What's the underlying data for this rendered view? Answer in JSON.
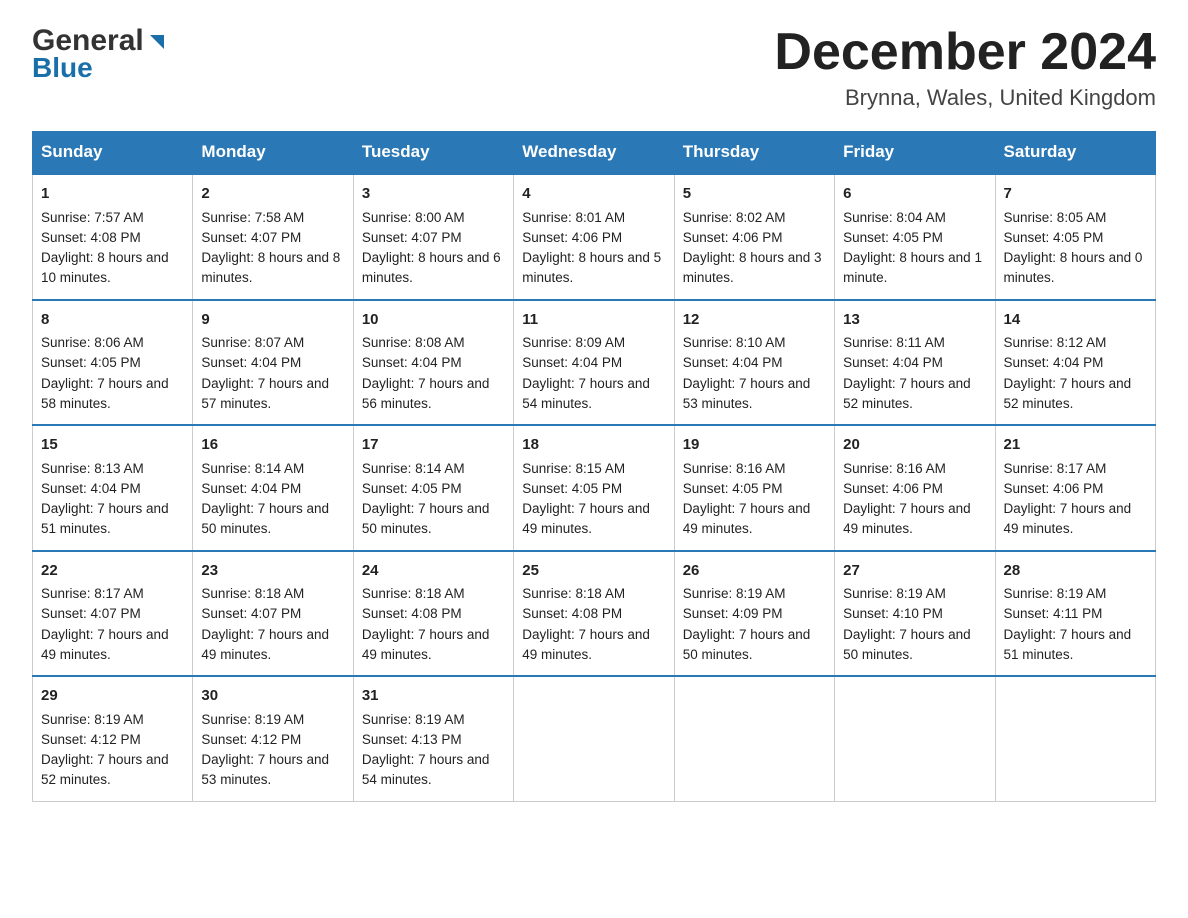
{
  "logo": {
    "general": "General",
    "triangle": "▶",
    "blue": "Blue"
  },
  "title": {
    "month": "December 2024",
    "location": "Brynna, Wales, United Kingdom"
  },
  "headers": [
    "Sunday",
    "Monday",
    "Tuesday",
    "Wednesday",
    "Thursday",
    "Friday",
    "Saturday"
  ],
  "weeks": [
    [
      {
        "day": "1",
        "sunrise": "7:57 AM",
        "sunset": "4:08 PM",
        "daylight": "8 hours and 10 minutes."
      },
      {
        "day": "2",
        "sunrise": "7:58 AM",
        "sunset": "4:07 PM",
        "daylight": "8 hours and 8 minutes."
      },
      {
        "day": "3",
        "sunrise": "8:00 AM",
        "sunset": "4:07 PM",
        "daylight": "8 hours and 6 minutes."
      },
      {
        "day": "4",
        "sunrise": "8:01 AM",
        "sunset": "4:06 PM",
        "daylight": "8 hours and 5 minutes."
      },
      {
        "day": "5",
        "sunrise": "8:02 AM",
        "sunset": "4:06 PM",
        "daylight": "8 hours and 3 minutes."
      },
      {
        "day": "6",
        "sunrise": "8:04 AM",
        "sunset": "4:05 PM",
        "daylight": "8 hours and 1 minute."
      },
      {
        "day": "7",
        "sunrise": "8:05 AM",
        "sunset": "4:05 PM",
        "daylight": "8 hours and 0 minutes."
      }
    ],
    [
      {
        "day": "8",
        "sunrise": "8:06 AM",
        "sunset": "4:05 PM",
        "daylight": "7 hours and 58 minutes."
      },
      {
        "day": "9",
        "sunrise": "8:07 AM",
        "sunset": "4:04 PM",
        "daylight": "7 hours and 57 minutes."
      },
      {
        "day": "10",
        "sunrise": "8:08 AM",
        "sunset": "4:04 PM",
        "daylight": "7 hours and 56 minutes."
      },
      {
        "day": "11",
        "sunrise": "8:09 AM",
        "sunset": "4:04 PM",
        "daylight": "7 hours and 54 minutes."
      },
      {
        "day": "12",
        "sunrise": "8:10 AM",
        "sunset": "4:04 PM",
        "daylight": "7 hours and 53 minutes."
      },
      {
        "day": "13",
        "sunrise": "8:11 AM",
        "sunset": "4:04 PM",
        "daylight": "7 hours and 52 minutes."
      },
      {
        "day": "14",
        "sunrise": "8:12 AM",
        "sunset": "4:04 PM",
        "daylight": "7 hours and 52 minutes."
      }
    ],
    [
      {
        "day": "15",
        "sunrise": "8:13 AM",
        "sunset": "4:04 PM",
        "daylight": "7 hours and 51 minutes."
      },
      {
        "day": "16",
        "sunrise": "8:14 AM",
        "sunset": "4:04 PM",
        "daylight": "7 hours and 50 minutes."
      },
      {
        "day": "17",
        "sunrise": "8:14 AM",
        "sunset": "4:05 PM",
        "daylight": "7 hours and 50 minutes."
      },
      {
        "day": "18",
        "sunrise": "8:15 AM",
        "sunset": "4:05 PM",
        "daylight": "7 hours and 49 minutes."
      },
      {
        "day": "19",
        "sunrise": "8:16 AM",
        "sunset": "4:05 PM",
        "daylight": "7 hours and 49 minutes."
      },
      {
        "day": "20",
        "sunrise": "8:16 AM",
        "sunset": "4:06 PM",
        "daylight": "7 hours and 49 minutes."
      },
      {
        "day": "21",
        "sunrise": "8:17 AM",
        "sunset": "4:06 PM",
        "daylight": "7 hours and 49 minutes."
      }
    ],
    [
      {
        "day": "22",
        "sunrise": "8:17 AM",
        "sunset": "4:07 PM",
        "daylight": "7 hours and 49 minutes."
      },
      {
        "day": "23",
        "sunrise": "8:18 AM",
        "sunset": "4:07 PM",
        "daylight": "7 hours and 49 minutes."
      },
      {
        "day": "24",
        "sunrise": "8:18 AM",
        "sunset": "4:08 PM",
        "daylight": "7 hours and 49 minutes."
      },
      {
        "day": "25",
        "sunrise": "8:18 AM",
        "sunset": "4:08 PM",
        "daylight": "7 hours and 49 minutes."
      },
      {
        "day": "26",
        "sunrise": "8:19 AM",
        "sunset": "4:09 PM",
        "daylight": "7 hours and 50 minutes."
      },
      {
        "day": "27",
        "sunrise": "8:19 AM",
        "sunset": "4:10 PM",
        "daylight": "7 hours and 50 minutes."
      },
      {
        "day": "28",
        "sunrise": "8:19 AM",
        "sunset": "4:11 PM",
        "daylight": "7 hours and 51 minutes."
      }
    ],
    [
      {
        "day": "29",
        "sunrise": "8:19 AM",
        "sunset": "4:12 PM",
        "daylight": "7 hours and 52 minutes."
      },
      {
        "day": "30",
        "sunrise": "8:19 AM",
        "sunset": "4:12 PM",
        "daylight": "7 hours and 53 minutes."
      },
      {
        "day": "31",
        "sunrise": "8:19 AM",
        "sunset": "4:13 PM",
        "daylight": "7 hours and 54 minutes."
      },
      null,
      null,
      null,
      null
    ]
  ]
}
